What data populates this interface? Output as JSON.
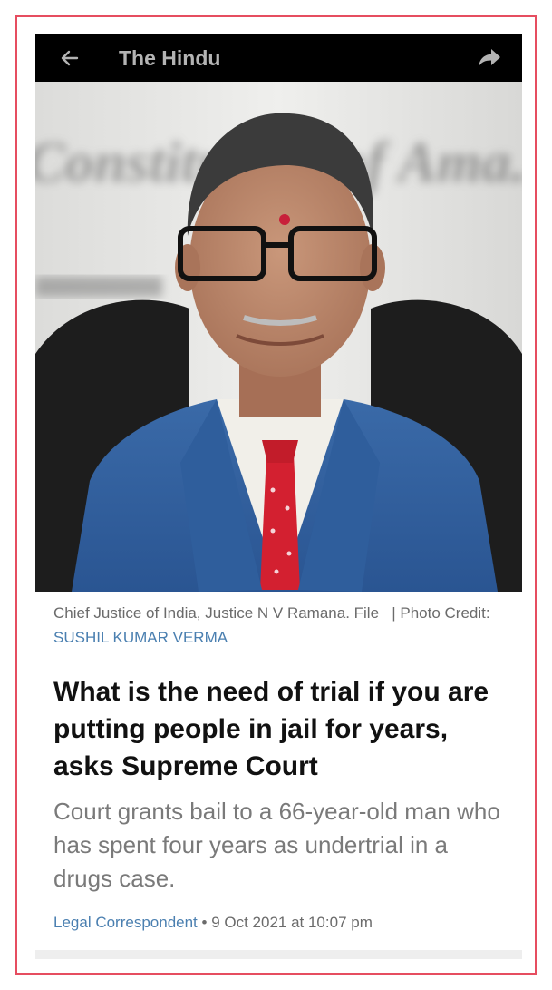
{
  "app_bar": {
    "title": "The Hindu",
    "back_icon": "arrow-left-icon",
    "share_icon": "share-arrow-icon"
  },
  "photo": {
    "background_text": "Constitution of Ama..."
  },
  "caption": {
    "text": "Chief Justice of India, Justice N V Ramana. File",
    "credit_prefix": "| Photo Credit:",
    "credit_name": "SUSHIL KUMAR VERMA"
  },
  "article": {
    "headline": "What is the need of trial if you are putting people in jail for years, asks Supreme Court",
    "subhead": "Court grants bail to a 66-year-old man who has spent four years as undertrial in a drugs case.",
    "author": "Legal Correspondent",
    "separator": " • ",
    "date": "9 Oct 2021 at 10:07 pm"
  },
  "colors": {
    "frame_border": "#e64d60",
    "app_bar_bg": "#000000",
    "link_blue": "#4a7fb0"
  }
}
